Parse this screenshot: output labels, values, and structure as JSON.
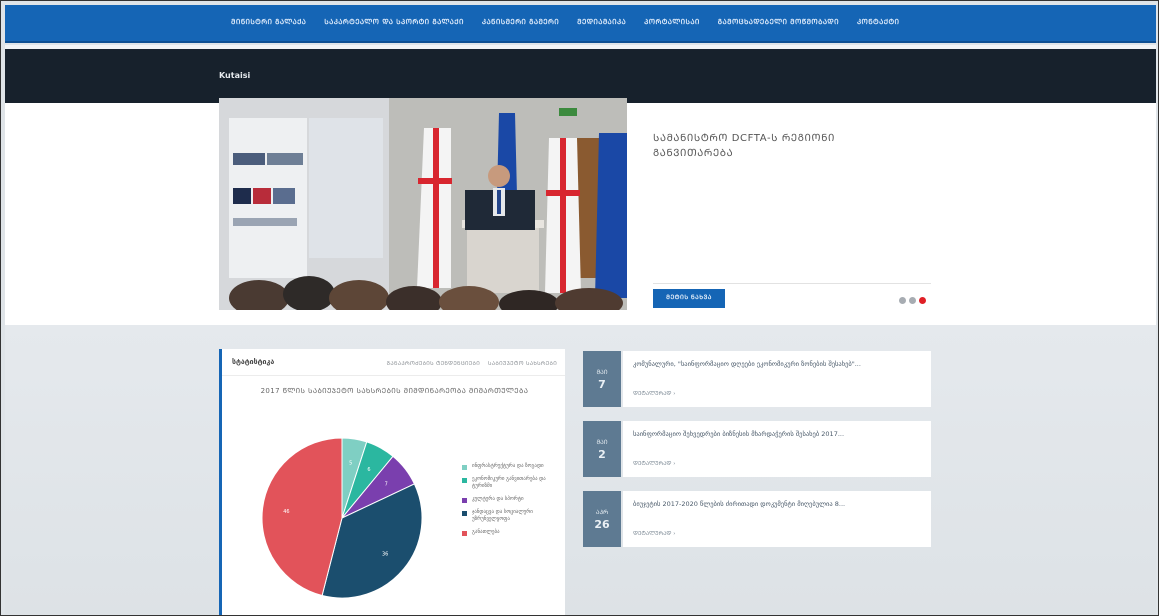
{
  "nav": {
    "items": [
      "ᲛᲘᲜᲘᲡᲢᲠᲘ ᲒᲐᲚᲐᲥᲐ",
      "ᲡᲐᲙᲐᲠᲢᲔᲐᲚᲝ ᲓᲐ ᲡᲞᲝᲠᲢᲘ ᲒᲐᲚᲐᲥᲘ",
      "ᲙᲐᲜᲘᲡᲛᲔᲠᲘ ᲒᲐᲛᲔᲠᲘ",
      "ᲛᲔᲓᲘᲐᲛᲐᲘᲙᲐ",
      "ᲞᲝᲠᲢᲐᲚᲘᲡᲐᲘ",
      "ᲒᲐᲛᲝᲪᲮᲐᲓᲔᲑᲔᲚᲘ ᲛᲝᲬᲛᲝᲑᲐᲓᲘ",
      "ᲙᲝᲜᲢᲐᲥᲢᲘ"
    ]
  },
  "header": {
    "brand": "Kutaisi"
  },
  "hero": {
    "title": "ᲡᲐᲛᲐᲜᲘᲡᲢᲠᲝ DCFTA-Ს ᲠᲔᲒᲘᲝᲜᲘ ᲒᲐᲜᲕᲘᲗᲐᲠᲔᲑᲐ",
    "button": "ᲛᲔᲢᲘᲡ ᲜᲐᲮᲕᲐ",
    "slides": 3,
    "active_slide": 3
  },
  "stats": {
    "heading": "სტატისტიკა",
    "tabs": [
      "ᲒᲐᲜᲐᲞᲠᲝᲫᲔᲑᲘᲡ ᲢᲔᲜᲓᲔᲜᲪᲘᲔᲑᲘ",
      "ᲡᲐᲑᲘᲣᲯᲔᲢᲝ ᲡᲐᲮᲡᲠᲔᲑᲘ"
    ],
    "chart_title": "2017 ᲬᲚᲘᲡ ᲡᲐᲑᲘᲣᲯᲔᲢᲝ ᲡᲐᲮᲡᲠᲔᲑᲘᲡ ᲛᲘᲛᲓᲘᲜᲐᲠᲔᲝᲑᲐ ᲛᲘᲛᲐᲠᲗᲣᲚᲔᲑᲐ"
  },
  "chart_data": {
    "type": "pie",
    "title": "2017 ᲬᲚᲘᲡ ᲡᲐᲑᲘᲣᲯᲔᲢᲝ ᲡᲐᲮᲡᲠᲔᲑᲘᲡ ᲛᲘᲛᲓᲘᲜᲐᲠᲔᲝᲑᲐ ᲛᲘᲛᲐᲠᲗᲣᲚᲔᲑᲐ",
    "slices": [
      {
        "label": "ინფრასტრუქტურა და ზოგადი",
        "value": 5,
        "color": "#7fcfc3"
      },
      {
        "label": "ეკონომიკური განვითარება და ტურიზმი",
        "value": 6,
        "color": "#2bb7a0"
      },
      {
        "label": "კულტურა და სპორტი",
        "value": 7,
        "color": "#7a3fae"
      },
      {
        "label": "ჯანდაცვა და სოციალური უზრუნველყოფა",
        "value": 36,
        "color": "#1b4e6e"
      },
      {
        "label": "განათლება",
        "value": 46,
        "color": "#e2535a"
      }
    ],
    "legend": "right"
  },
  "news": [
    {
      "month": "ᲛᲐᲘ",
      "day": "7",
      "title": "კომუნალური, \"საინფორმაციო დღეები ეკონომიკური ზონების შესახებ\"...",
      "more": "ᲓᲔᲢᲐᲚᲣᲠᲐᲓ ›"
    },
    {
      "month": "ᲛᲐᲘ",
      "day": "2",
      "title": "საინფორმაციო შეხვედრები ბიზნესის მხარდაჭერის შესახებ 2017...",
      "more": "ᲓᲔᲢᲐᲚᲣᲠᲐᲓ ›"
    },
    {
      "month": "ᲐᲞᲠ",
      "day": "26",
      "title": "ბიუჯეტის 2017-2020 წლების ძირითადი დოკუმენტი მიღებულია 8...",
      "more": "ᲓᲔᲢᲐᲚᲣᲠᲐᲓ ›"
    }
  ]
}
